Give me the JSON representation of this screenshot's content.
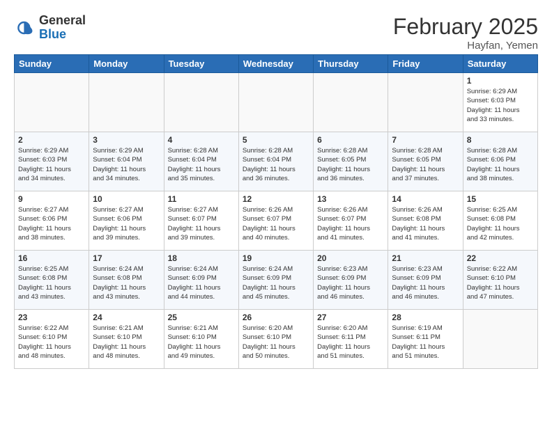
{
  "header": {
    "logo_general": "General",
    "logo_blue": "Blue",
    "month_title": "February 2025",
    "location": "Hayfan, Yemen"
  },
  "weekdays": [
    "Sunday",
    "Monday",
    "Tuesday",
    "Wednesday",
    "Thursday",
    "Friday",
    "Saturday"
  ],
  "weeks": [
    [
      {
        "day": "",
        "info": ""
      },
      {
        "day": "",
        "info": ""
      },
      {
        "day": "",
        "info": ""
      },
      {
        "day": "",
        "info": ""
      },
      {
        "day": "",
        "info": ""
      },
      {
        "day": "",
        "info": ""
      },
      {
        "day": "1",
        "info": "Sunrise: 6:29 AM\nSunset: 6:03 PM\nDaylight: 11 hours\nand 33 minutes."
      }
    ],
    [
      {
        "day": "2",
        "info": "Sunrise: 6:29 AM\nSunset: 6:03 PM\nDaylight: 11 hours\nand 34 minutes."
      },
      {
        "day": "3",
        "info": "Sunrise: 6:29 AM\nSunset: 6:04 PM\nDaylight: 11 hours\nand 34 minutes."
      },
      {
        "day": "4",
        "info": "Sunrise: 6:28 AM\nSunset: 6:04 PM\nDaylight: 11 hours\nand 35 minutes."
      },
      {
        "day": "5",
        "info": "Sunrise: 6:28 AM\nSunset: 6:04 PM\nDaylight: 11 hours\nand 36 minutes."
      },
      {
        "day": "6",
        "info": "Sunrise: 6:28 AM\nSunset: 6:05 PM\nDaylight: 11 hours\nand 36 minutes."
      },
      {
        "day": "7",
        "info": "Sunrise: 6:28 AM\nSunset: 6:05 PM\nDaylight: 11 hours\nand 37 minutes."
      },
      {
        "day": "8",
        "info": "Sunrise: 6:28 AM\nSunset: 6:06 PM\nDaylight: 11 hours\nand 38 minutes."
      }
    ],
    [
      {
        "day": "9",
        "info": "Sunrise: 6:27 AM\nSunset: 6:06 PM\nDaylight: 11 hours\nand 38 minutes."
      },
      {
        "day": "10",
        "info": "Sunrise: 6:27 AM\nSunset: 6:06 PM\nDaylight: 11 hours\nand 39 minutes."
      },
      {
        "day": "11",
        "info": "Sunrise: 6:27 AM\nSunset: 6:07 PM\nDaylight: 11 hours\nand 39 minutes."
      },
      {
        "day": "12",
        "info": "Sunrise: 6:26 AM\nSunset: 6:07 PM\nDaylight: 11 hours\nand 40 minutes."
      },
      {
        "day": "13",
        "info": "Sunrise: 6:26 AM\nSunset: 6:07 PM\nDaylight: 11 hours\nand 41 minutes."
      },
      {
        "day": "14",
        "info": "Sunrise: 6:26 AM\nSunset: 6:08 PM\nDaylight: 11 hours\nand 41 minutes."
      },
      {
        "day": "15",
        "info": "Sunrise: 6:25 AM\nSunset: 6:08 PM\nDaylight: 11 hours\nand 42 minutes."
      }
    ],
    [
      {
        "day": "16",
        "info": "Sunrise: 6:25 AM\nSunset: 6:08 PM\nDaylight: 11 hours\nand 43 minutes."
      },
      {
        "day": "17",
        "info": "Sunrise: 6:24 AM\nSunset: 6:08 PM\nDaylight: 11 hours\nand 43 minutes."
      },
      {
        "day": "18",
        "info": "Sunrise: 6:24 AM\nSunset: 6:09 PM\nDaylight: 11 hours\nand 44 minutes."
      },
      {
        "day": "19",
        "info": "Sunrise: 6:24 AM\nSunset: 6:09 PM\nDaylight: 11 hours\nand 45 minutes."
      },
      {
        "day": "20",
        "info": "Sunrise: 6:23 AM\nSunset: 6:09 PM\nDaylight: 11 hours\nand 46 minutes."
      },
      {
        "day": "21",
        "info": "Sunrise: 6:23 AM\nSunset: 6:09 PM\nDaylight: 11 hours\nand 46 minutes."
      },
      {
        "day": "22",
        "info": "Sunrise: 6:22 AM\nSunset: 6:10 PM\nDaylight: 11 hours\nand 47 minutes."
      }
    ],
    [
      {
        "day": "23",
        "info": "Sunrise: 6:22 AM\nSunset: 6:10 PM\nDaylight: 11 hours\nand 48 minutes."
      },
      {
        "day": "24",
        "info": "Sunrise: 6:21 AM\nSunset: 6:10 PM\nDaylight: 11 hours\nand 48 minutes."
      },
      {
        "day": "25",
        "info": "Sunrise: 6:21 AM\nSunset: 6:10 PM\nDaylight: 11 hours\nand 49 minutes."
      },
      {
        "day": "26",
        "info": "Sunrise: 6:20 AM\nSunset: 6:10 PM\nDaylight: 11 hours\nand 50 minutes."
      },
      {
        "day": "27",
        "info": "Sunrise: 6:20 AM\nSunset: 6:11 PM\nDaylight: 11 hours\nand 51 minutes."
      },
      {
        "day": "28",
        "info": "Sunrise: 6:19 AM\nSunset: 6:11 PM\nDaylight: 11 hours\nand 51 minutes."
      },
      {
        "day": "",
        "info": ""
      }
    ]
  ]
}
